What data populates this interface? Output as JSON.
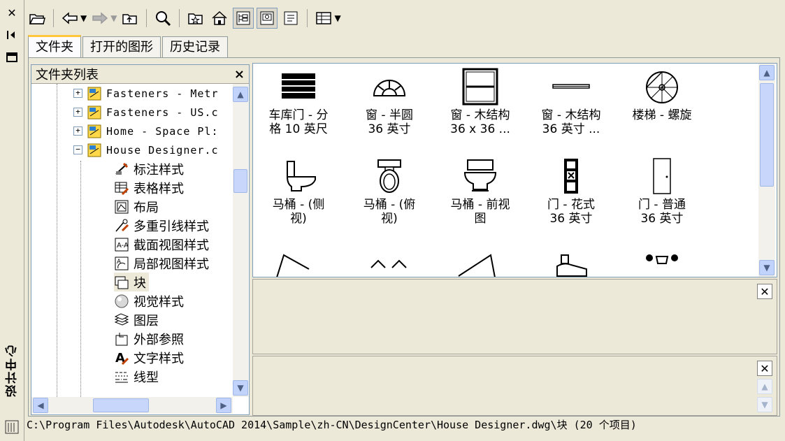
{
  "window": {
    "vertical_title": "设计中心",
    "close_icon": "close-icon",
    "pin_icon": "autohide-icon",
    "props_icon": "properties-icon"
  },
  "tabs": [
    {
      "label": "文件夹",
      "active": true
    },
    {
      "label": "打开的图形",
      "active": false
    },
    {
      "label": "历史记录",
      "active": false
    }
  ],
  "tree": {
    "header": "文件夹列表",
    "close_label": "×",
    "drawings": [
      {
        "label": "Fasteners - Metr",
        "expander": "+"
      },
      {
        "label": "Fasteners - US.c",
        "expander": "+"
      },
      {
        "label": "Home - Space Pl:",
        "expander": "+"
      },
      {
        "label": "House Designer.c",
        "expander": "−"
      }
    ],
    "children": [
      {
        "label": "标注样式",
        "icon": "dimension-style-icon"
      },
      {
        "label": "表格样式",
        "icon": "table-style-icon"
      },
      {
        "label": "布局",
        "icon": "layout-icon"
      },
      {
        "label": "多重引线样式",
        "icon": "multileader-style-icon"
      },
      {
        "label": "截面视图样式",
        "icon": "section-view-style-icon"
      },
      {
        "label": "局部视图样式",
        "icon": "detail-view-style-icon"
      },
      {
        "label": "块",
        "icon": "block-icon",
        "selected": true
      },
      {
        "label": "视觉样式",
        "icon": "visual-style-icon"
      },
      {
        "label": "图层",
        "icon": "layer-icon"
      },
      {
        "label": "外部参照",
        "icon": "xref-icon"
      },
      {
        "label": "文字样式",
        "icon": "text-style-icon"
      },
      {
        "label": "线型",
        "icon": "linetype-icon"
      }
    ]
  },
  "blocks": [
    {
      "line1": "车库门 - 分",
      "line2": "格 10 英尺",
      "icon": "garage-door-icon"
    },
    {
      "line1": "窗 - 半圆",
      "line2": "36 英寸",
      "icon": "half-round-window-icon"
    },
    {
      "line1": "窗 - 木结构",
      "line2": "36 x 36 ...",
      "icon": "wood-window-icon"
    },
    {
      "line1": "窗 - 木结构",
      "line2": "36 英寸 ...",
      "icon": "wood-window-plan-icon"
    },
    {
      "line1": "楼梯 - 螺旋",
      "line2": "",
      "icon": "spiral-stair-icon"
    },
    {
      "line1": "马桶 - (侧",
      "line2": "视)",
      "icon": "toilet-side-icon"
    },
    {
      "line1": "马桶 - (俯",
      "line2": "视)",
      "icon": "toilet-top-icon"
    },
    {
      "line1": "马桶 - 前视",
      "line2": "图",
      "icon": "toilet-front-icon"
    },
    {
      "line1": "门 - 花式",
      "line2": "36 英寸",
      "icon": "fancy-door-icon"
    },
    {
      "line1": "门 - 普通",
      "line2": "36 英寸",
      "icon": "door-icon"
    }
  ],
  "status": "C:\\Program Files\\Autodesk\\AutoCAD 2014\\Sample\\zh-CN\\DesignCenter\\House Designer.dwg\\块 (20 个项目)"
}
